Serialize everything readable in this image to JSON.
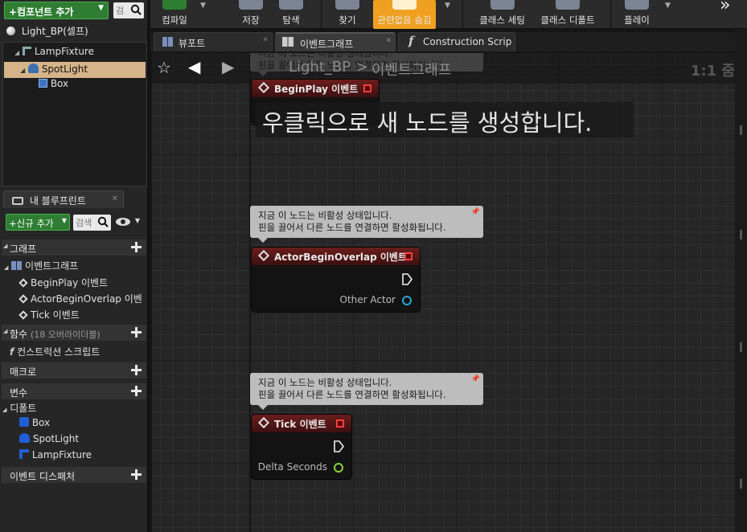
{
  "left_panel": {
    "add_component_label": "+컴포넌트 추가",
    "search_glyph": "검",
    "root_item": "Light_BP(셀프)",
    "tree": [
      {
        "label": "LampFixture",
        "icon": "static-mesh-icon"
      },
      {
        "label": "SpotLight",
        "icon": "spotlight-icon"
      },
      {
        "label": "Box",
        "icon": "box-icon"
      }
    ],
    "my_blueprint_tab": "내 블루프린트",
    "new_add_label": "+신규 추가",
    "search_placeholder": "검색",
    "sections": {
      "graph": "그래프",
      "event_graph": "이벤트그래프",
      "graph_items": [
        "BeginPlay 이벤트",
        "ActorBeginOverlap 이벤",
        "Tick 이벤트"
      ],
      "functions": "함수",
      "functions_note": "(18 오버라이더블)",
      "construction_script": "컨스트럭션 스크립트",
      "macros": "매크로",
      "variables": "변수",
      "defaults": "디폴트",
      "default_items": [
        "Box",
        "SpotLight",
        "LampFixture"
      ],
      "event_dispatchers": "이벤트 디스패처"
    }
  },
  "toolbar": {
    "buttons": [
      "컴파일",
      "저장",
      "탐색",
      "찾기",
      "관련없음 숨김",
      "클래스 세팅",
      "클래스 디폴트",
      "플레이"
    ],
    "more": "»",
    "active_color": "#f0a020"
  },
  "tabs": [
    {
      "label": "뷰포트",
      "icon": "viewport-icon"
    },
    {
      "label": "이벤트그래프",
      "icon": "event-graph-icon"
    },
    {
      "label": "Construction Scrip",
      "icon": "function-icon"
    }
  ],
  "graph": {
    "breadcrumb_root": "Light_BP",
    "breadcrumb_sep": ">",
    "breadcrumb_current": "이벤트그래프",
    "zoom": "1:1 줌",
    "hint": "우클릭으로 새 노드를 생성합니다.",
    "bubble_text_1": "지금 이 노드는 비활성 상태입니다.",
    "bubble_text_2": "핀을 끌어서 다른 노드를 연결하면 활성화됩니다.",
    "nodes": {
      "begin_play": {
        "title": "BeginPlay 이벤트"
      },
      "begin_overlap": {
        "title": "ActorBeginOverlap 이벤트",
        "pin": "Other Actor"
      },
      "tick": {
        "title": "Tick 이벤트",
        "pin": "Delta Seconds"
      }
    }
  }
}
